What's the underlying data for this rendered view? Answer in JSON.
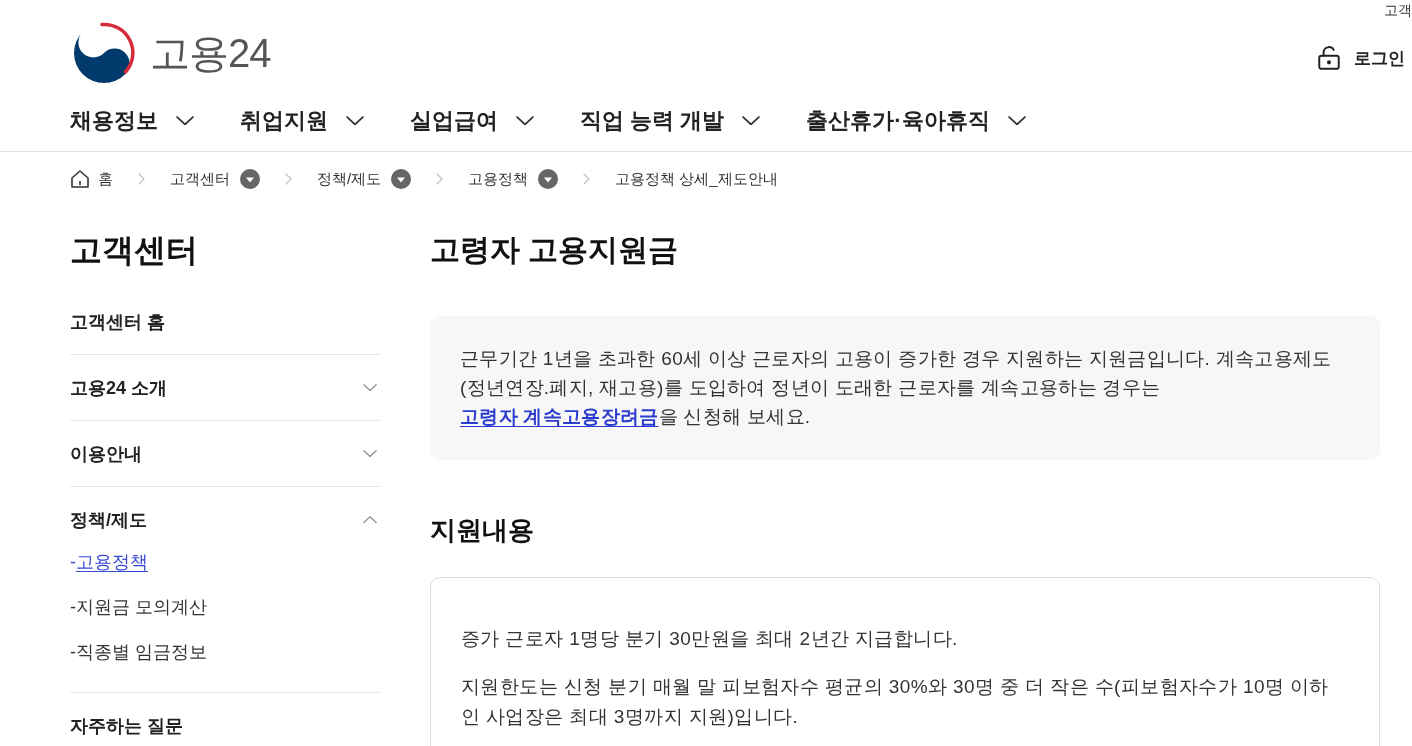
{
  "top_bar": {
    "link": "고객"
  },
  "header": {
    "logo_text": "고용24",
    "login": "로그인"
  },
  "nav": [
    {
      "label": "채용정보"
    },
    {
      "label": "취업지원"
    },
    {
      "label": "실업급여"
    },
    {
      "label": "직업 능력 개발"
    },
    {
      "label": "출산휴가·육아휴직"
    }
  ],
  "breadcrumb": [
    {
      "kind": "home",
      "label": "홈"
    },
    {
      "kind": "dropdown",
      "label": "고객센터"
    },
    {
      "kind": "dropdown",
      "label": "정책/제도"
    },
    {
      "kind": "dropdown",
      "label": "고용정책"
    },
    {
      "kind": "current",
      "label": "고용정책 상세_제도안내"
    }
  ],
  "sidebar": {
    "title": "고객센터",
    "items": [
      {
        "kind": "link",
        "label": "고객센터 홈"
      },
      {
        "kind": "group",
        "label": "고용24 소개",
        "expanded": false
      },
      {
        "kind": "group",
        "label": "이용안내",
        "expanded": false
      },
      {
        "kind": "group",
        "label": "정책/제도",
        "expanded": true,
        "children": [
          {
            "bullet": "-",
            "label": "고용정책",
            "selected": true
          },
          {
            "bullet": "-",
            "label": "지원금 모의계산",
            "selected": false
          },
          {
            "bullet": "-",
            "label": "직종별 임금정보",
            "selected": false
          }
        ]
      },
      {
        "kind": "link",
        "label": "자주하는 질문"
      }
    ]
  },
  "main": {
    "title": "고령자 고용지원금",
    "intro": {
      "text": "근무기간 1년을 초과한 60세 이상 근로자의 고용이 증가한 경우 지원하는 지원금입니다. 계속고용제도(정년연장.폐지, 재고용)를 도입하여 정년이 도래한 근로자를 계속고용하는 경우는 ",
      "link": "고령자 계속고용장려금",
      "text_after": "을 신청해 보세요."
    },
    "section": {
      "heading": "지원내용",
      "paragraphs": [
        "증가 근로자 1명당 분기 30만원을 최대 2년간 지급합니다.",
        "지원한도는 신청 분기 매월 말 피보험자수 평균의 30%와 30명 중 더 작은 수(피보험자수가 10명 이하 인 사업장은 최대 3명까지 지원)입니다."
      ]
    }
  }
}
